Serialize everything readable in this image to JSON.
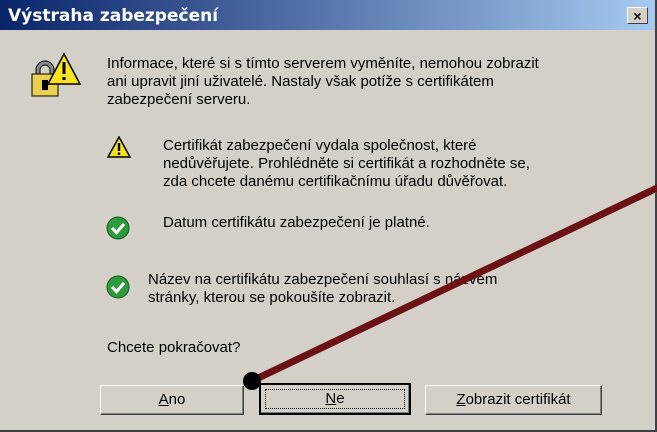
{
  "window": {
    "title": "Výstraha zabezpečení",
    "close_label": "×"
  },
  "intro": {
    "line1": "Informace, které si s tímto serverem vyměníte, nemohou zobrazit",
    "line2": "ani upravit jiní uživatelé. Nastaly však potíže s certifikátem",
    "line3": "zabezpečení serveru."
  },
  "items": [
    {
      "icon": "warning-icon",
      "lines": [
        "Certifikát zabezpečení vydala společnost, které",
        "nedůvěřujete. Prohlédněte si certifikát a rozhodněte se,",
        "zda chcete danému certifikačnímu úřadu důvěřovat."
      ]
    },
    {
      "icon": "check-icon",
      "lines": [
        "Datum certifikátu zabezpečení je platné."
      ]
    },
    {
      "icon": "check-icon",
      "lines": [
        "Název na certifikátu zabezpečení souhlasí s názvem",
        "stránky, kterou se pokoušíte zobrazit."
      ]
    }
  ],
  "question": "Chcete pokračovat?",
  "buttons": {
    "yes": {
      "accel": "A",
      "rest": "no"
    },
    "no": {
      "accel": "N",
      "rest": "e"
    },
    "view": {
      "accel": "Z",
      "rest": "obrazit certifikát"
    }
  },
  "colors": {
    "titlebar": "#0a246a",
    "annotation_line": "#6b1216",
    "check": "#2e9a3e",
    "warning": "#f0e020"
  }
}
